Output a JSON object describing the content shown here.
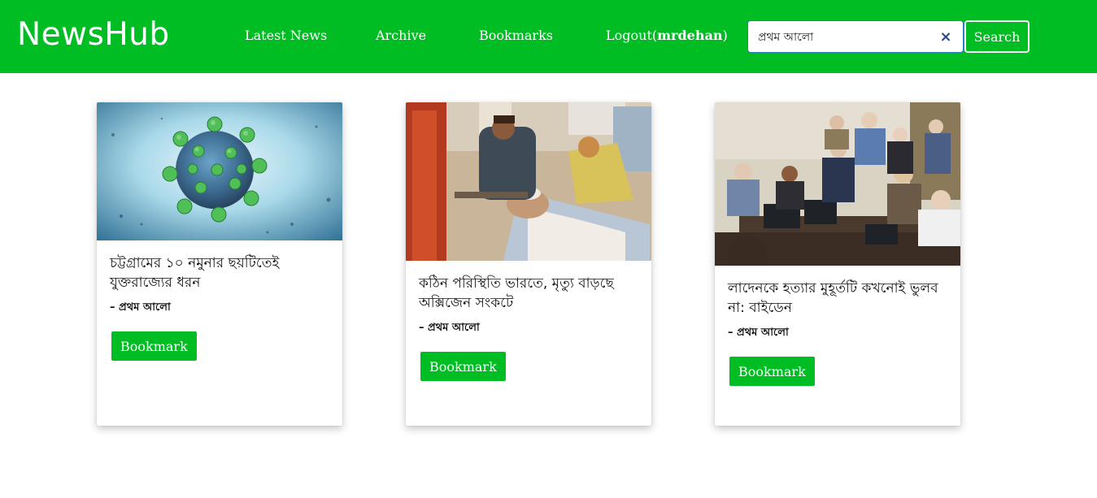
{
  "header": {
    "brand": "NewsHub",
    "nav": {
      "latest": "Latest News",
      "archive": "Archive",
      "bookmarks": "Bookmarks",
      "logout_prefix": "Logout(",
      "username": "mrdehan",
      "logout_suffix": ")"
    },
    "search": {
      "value": "প্রথম আলো",
      "clear_icon": "close-icon",
      "button_label": "Search"
    }
  },
  "articles": [
    {
      "title": "চট্টগ্রামের ১০ নমুনার ছয়টিতেই যুক্তরাজ্যের ধরন",
      "source": "– প্রথম আলো",
      "bookmark_label": "Bookmark",
      "image": "coronavirus-illustration"
    },
    {
      "title": "কঠিন পরিস্থিতি ভারতে, মৃত্যু বাড়ছে অক্সিজেন সংকটে",
      "source": "– প্রথম আলো",
      "bookmark_label": "Bookmark",
      "image": "hospital-oxygen-patient-photo"
    },
    {
      "title": "লাদেনকে হত্যার মুহূর্তটি কখনোই ভুলব না: বাইডেন",
      "source": "– প্রথম আলো",
      "bookmark_label": "Bookmark",
      "image": "situation-room-photo"
    }
  ],
  "colors": {
    "brand_green": "#00bd23",
    "white": "#ffffff",
    "text": "#111111"
  }
}
